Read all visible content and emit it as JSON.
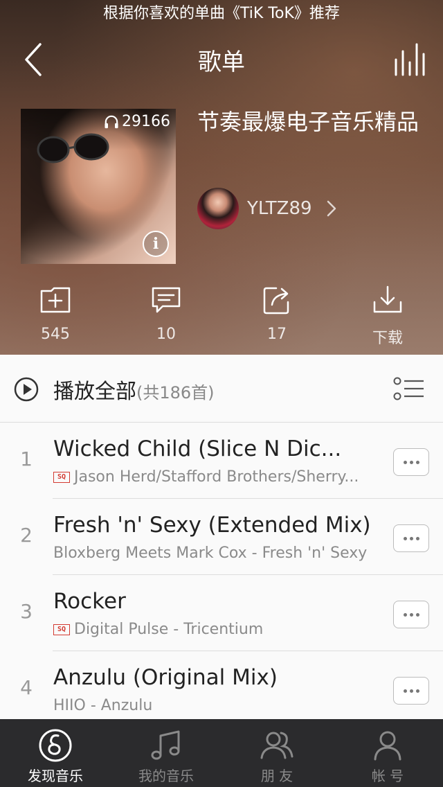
{
  "notification": "根据你喜欢的单曲《TiK ToK》推荐",
  "header": {
    "title": "歌单"
  },
  "playlist": {
    "play_count": "29166",
    "title": "节奏最爆电子音乐精品",
    "creator": "YLTZ89"
  },
  "actions": [
    {
      "icon": "add-folder-icon",
      "label": "545"
    },
    {
      "icon": "comment-icon",
      "label": "10"
    },
    {
      "icon": "share-icon",
      "label": "17"
    },
    {
      "icon": "download-icon",
      "label": "下载"
    }
  ],
  "list": {
    "play_all_label": "播放全部",
    "play_all_count": "(共186首)",
    "songs": [
      {
        "index": "1",
        "title": "Wicked Child (Slice N Dic...",
        "sq": true,
        "sq_label": "SQ",
        "artist": "Jason Herd/Stafford Brothers/Sherry..."
      },
      {
        "index": "2",
        "title": "Fresh 'n' Sexy (Extended Mix)",
        "sq": false,
        "artist": "Bloxberg Meets Mark Cox - Fresh 'n' Sexy"
      },
      {
        "index": "3",
        "title": "Rocker",
        "sq": true,
        "sq_label": "SQ",
        "artist": "Digital Pulse - Tricentium"
      },
      {
        "index": "4",
        "title": "Anzulu (Original Mix)",
        "sq": false,
        "artist": "HIIO - Anzulu"
      }
    ]
  },
  "tabbar": [
    {
      "label": "发现音乐",
      "icon": "netease-music-icon",
      "active": true
    },
    {
      "label": "我的音乐",
      "icon": "music-note-icon",
      "active": false
    },
    {
      "label": "朋 友",
      "icon": "friends-icon",
      "active": false
    },
    {
      "label": "帐 号",
      "icon": "account-icon",
      "active": false
    }
  ]
}
